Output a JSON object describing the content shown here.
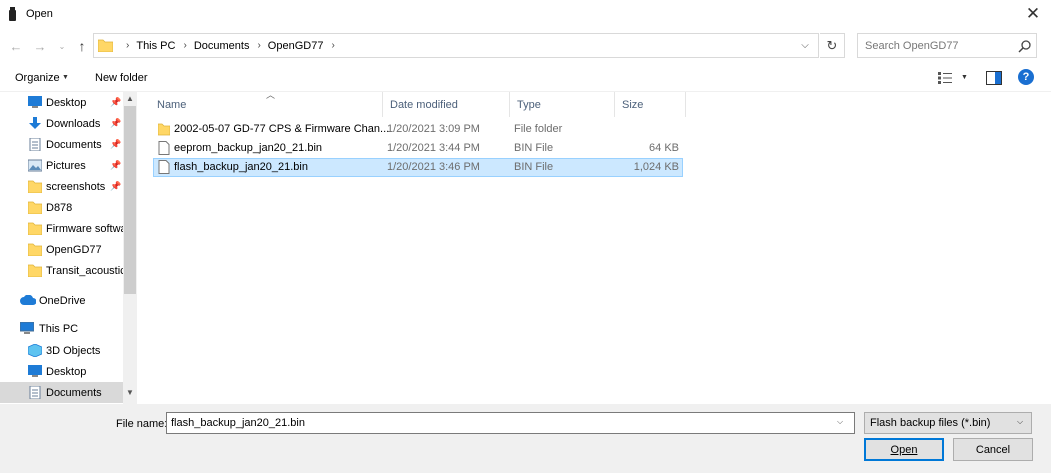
{
  "window": {
    "title": "Open"
  },
  "nav": {
    "back_glyph": "←",
    "forward_glyph": "→",
    "recent_glyph": "⌄",
    "up_glyph": "↑",
    "breadcrumb": [
      "This PC",
      "Documents",
      "OpenGD77"
    ],
    "refresh_glyph": "↻",
    "search_placeholder": "Search OpenGD77"
  },
  "toolbar": {
    "organize_label": "Organize",
    "new_folder_label": "New folder",
    "help_glyph": "?"
  },
  "sidebar": {
    "quick_access": [
      {
        "label": "Desktop",
        "icon": "desktop-icon",
        "pinned": true
      },
      {
        "label": "Downloads",
        "icon": "downloads-icon",
        "pinned": true
      },
      {
        "label": "Documents",
        "icon": "documents-icon",
        "pinned": true
      },
      {
        "label": "Pictures",
        "icon": "pictures-icon",
        "pinned": true
      },
      {
        "label": "screenshots",
        "icon": "folder-icon",
        "pinned": true
      },
      {
        "label": "D878",
        "icon": "folder-icon",
        "pinned": false
      },
      {
        "label": "Firmware softwa",
        "icon": "folder-icon",
        "pinned": false
      },
      {
        "label": "OpenGD77",
        "icon": "folder-icon",
        "pinned": false
      },
      {
        "label": "Transit_acoustic",
        "icon": "folder-icon",
        "pinned": false
      }
    ],
    "onedrive": {
      "label": "OneDrive",
      "icon": "cloud-icon"
    },
    "this_pc": {
      "label": "This PC",
      "icon": "computer-icon"
    },
    "this_pc_items": [
      {
        "label": "3D Objects",
        "icon": "3d-objects-icon"
      },
      {
        "label": "Desktop",
        "icon": "desktop-icon"
      },
      {
        "label": "Documents",
        "icon": "documents-icon",
        "selected": true
      }
    ]
  },
  "columns": {
    "name": "Name",
    "date": "Date modified",
    "type": "Type",
    "size": "Size"
  },
  "files": [
    {
      "name": "2002-05-07 GD-77 CPS & Firmware Chan...",
      "date": "1/20/2021 3:09 PM",
      "type": "File folder",
      "size": "",
      "icon": "folder-icon",
      "selected": false
    },
    {
      "name": "eeprom_backup_jan20_21.bin",
      "date": "1/20/2021 3:44 PM",
      "type": "BIN File",
      "size": "64 KB",
      "icon": "file-icon",
      "selected": false
    },
    {
      "name": "flash_backup_jan20_21.bin",
      "date": "1/20/2021 3:46 PM",
      "type": "BIN File",
      "size": "1,024 KB",
      "icon": "file-icon",
      "selected": true
    }
  ],
  "footer": {
    "filename_label": "File name:",
    "filename_value": "flash_backup_jan20_21.bin",
    "filetype_value": "Flash backup files (*.bin)",
    "open_label": "Open",
    "cancel_label": "Cancel"
  },
  "colors": {
    "selection": "#cce8ff",
    "selection_border": "#99d1ff",
    "folder": "#ffd766",
    "accent": "#0078d7"
  }
}
